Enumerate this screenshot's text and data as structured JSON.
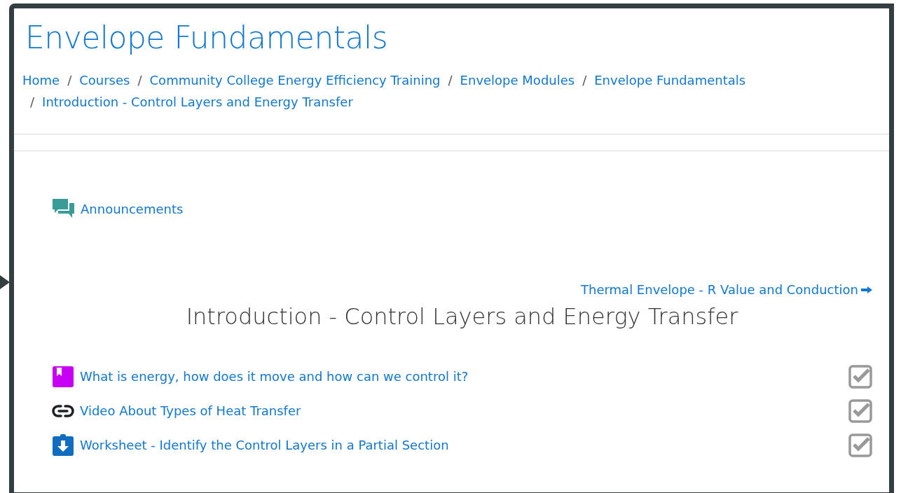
{
  "page_title": "Envelope Fundamentals",
  "breadcrumb_separator": "/",
  "breadcrumb": [
    "Home",
    "Courses",
    "Community College Energy Efficiency Training",
    "Envelope Modules",
    "Envelope Fundamentals",
    "Introduction - Control Layers and Energy Transfer"
  ],
  "announcements": {
    "label": "Announcements"
  },
  "next_link": {
    "label": "Thermal Envelope - R Value and Conduction"
  },
  "section_title": "Introduction - Control Layers and Energy Transfer",
  "activities": [
    {
      "kind": "page",
      "label": "What is energy, how does it move and how can we control it?",
      "completed": true
    },
    {
      "kind": "url",
      "label": "Video About Types of Heat Transfer",
      "completed": true
    },
    {
      "kind": "assign",
      "label": "Worksheet - Identify the Control Layers in a Partial Section",
      "completed": true
    }
  ]
}
